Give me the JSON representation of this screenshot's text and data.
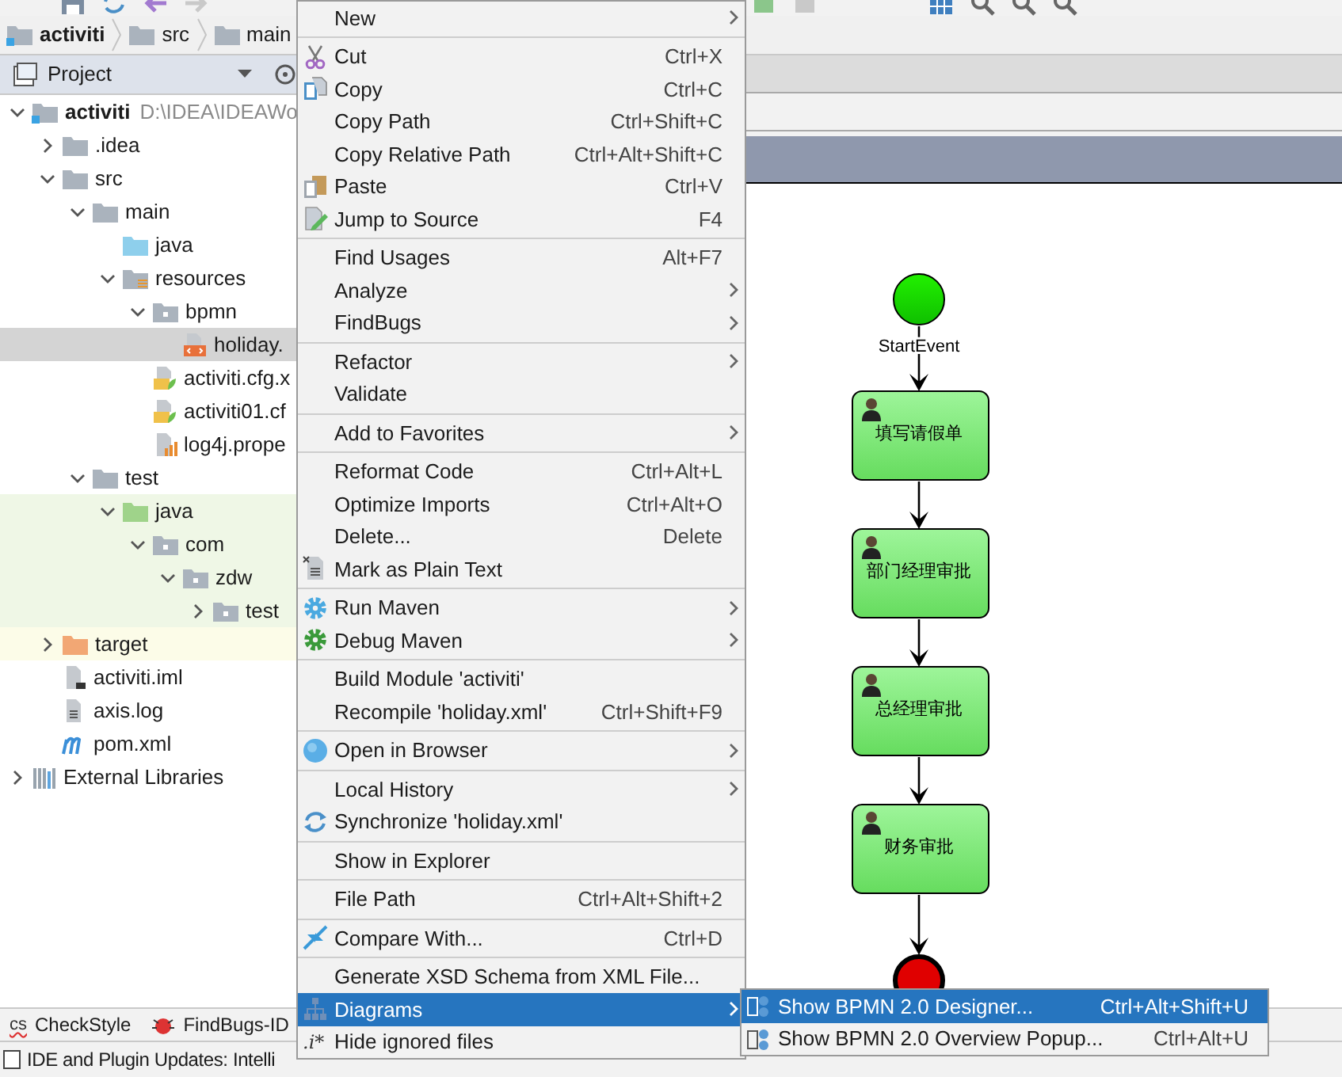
{
  "breadcrumb": [
    {
      "label": "activiti",
      "kind": "module"
    },
    {
      "label": "src",
      "kind": "folder"
    },
    {
      "label": "main",
      "kind": "folder"
    }
  ],
  "project_panel": {
    "title": "Project"
  },
  "tree": [
    {
      "label": "activiti",
      "path": "D:\\IDEA\\IDEAWo",
      "kind": "module",
      "expanded": true,
      "selected": false,
      "children": [
        {
          "label": ".idea",
          "kind": "folder",
          "expanded": false,
          "selected": false
        },
        {
          "label": "src",
          "kind": "folder",
          "expanded": true,
          "selected": false,
          "children": [
            {
              "label": "main",
              "kind": "folder",
              "expanded": true,
              "selected": false,
              "children": [
                {
                  "label": "java",
                  "kind": "source-folder",
                  "selected": false
                },
                {
                  "label": "resources",
                  "kind": "resources-folder",
                  "expanded": true,
                  "selected": false,
                  "children": [
                    {
                      "label": "bpmn",
                      "kind": "package",
                      "expanded": true,
                      "selected": false,
                      "children": [
                        {
                          "label": "holiday.",
                          "kind": "bpmn-file",
                          "selected": true
                        }
                      ]
                    },
                    {
                      "label": "activiti.cfg.x",
                      "kind": "spring-file",
                      "selected": false
                    },
                    {
                      "label": "activiti01.cf",
                      "kind": "spring-file",
                      "selected": false
                    },
                    {
                      "label": "log4j.prope",
                      "kind": "properties-file",
                      "selected": false
                    }
                  ]
                }
              ]
            },
            {
              "label": "test",
              "kind": "folder",
              "expanded": true,
              "selected": false,
              "children": [
                {
                  "label": "java",
                  "kind": "test-folder",
                  "expanded": true,
                  "selected": false,
                  "color": "#eff7e6",
                  "children": [
                    {
                      "label": "com",
                      "kind": "package",
                      "expanded": true,
                      "selected": false,
                      "color": "#eff7e6",
                      "children": [
                        {
                          "label": "zdw",
                          "kind": "package",
                          "expanded": true,
                          "selected": false,
                          "color": "#eff7e6",
                          "children": [
                            {
                              "label": "test",
                              "kind": "package",
                              "expanded": false,
                              "selected": false,
                              "color": "#eff7e6"
                            }
                          ]
                        }
                      ]
                    }
                  ]
                }
              ]
            }
          ]
        },
        {
          "label": "target",
          "kind": "excluded-folder",
          "expanded": false,
          "selected": false,
          "color": "#fcfce8"
        },
        {
          "label": "activiti.iml",
          "kind": "iml-file",
          "selected": false
        },
        {
          "label": "axis.log",
          "kind": "log-file",
          "selected": false
        },
        {
          "label": "pom.xml",
          "kind": "maven-file",
          "selected": false
        }
      ]
    },
    {
      "label": "External Libraries",
      "kind": "libraries",
      "expanded": false,
      "selected": false
    }
  ],
  "context_menu": [
    {
      "kind": "item",
      "label": "New",
      "submenu": true,
      "selected": false
    },
    {
      "kind": "separator"
    },
    {
      "kind": "item",
      "label": "Cut",
      "shortcut": "Ctrl+X",
      "submenu": false,
      "selected": false
    },
    {
      "kind": "item",
      "label": "Copy",
      "shortcut": "Ctrl+C",
      "submenu": false,
      "selected": false
    },
    {
      "kind": "item",
      "label": "Copy Path",
      "shortcut": "Ctrl+Shift+C",
      "submenu": false,
      "selected": false
    },
    {
      "kind": "item",
      "label": "Copy Relative Path",
      "shortcut": "Ctrl+Alt+Shift+C",
      "submenu": false,
      "selected": false
    },
    {
      "kind": "item",
      "label": "Paste",
      "shortcut": "Ctrl+V",
      "submenu": false,
      "selected": false
    },
    {
      "kind": "item",
      "label": "Jump to Source",
      "shortcut": "F4",
      "submenu": false,
      "selected": false
    },
    {
      "kind": "separator"
    },
    {
      "kind": "item",
      "label": "Find Usages",
      "shortcut": "Alt+F7",
      "submenu": false,
      "selected": false
    },
    {
      "kind": "item",
      "label": "Analyze",
      "submenu": true,
      "selected": false
    },
    {
      "kind": "item",
      "label": "FindBugs",
      "submenu": true,
      "selected": false
    },
    {
      "kind": "separator"
    },
    {
      "kind": "item",
      "label": "Refactor",
      "submenu": true,
      "selected": false
    },
    {
      "kind": "item",
      "label": "Validate",
      "submenu": false,
      "selected": false
    },
    {
      "kind": "separator"
    },
    {
      "kind": "item",
      "label": "Add to Favorites",
      "submenu": true,
      "selected": false
    },
    {
      "kind": "separator"
    },
    {
      "kind": "item",
      "label": "Reformat Code",
      "shortcut": "Ctrl+Alt+L",
      "submenu": false,
      "selected": false
    },
    {
      "kind": "item",
      "label": "Optimize Imports",
      "shortcut": "Ctrl+Alt+O",
      "submenu": false,
      "selected": false
    },
    {
      "kind": "item",
      "label": "Delete...",
      "shortcut": "Delete",
      "submenu": false,
      "selected": false
    },
    {
      "kind": "item",
      "label": "Mark as Plain Text",
      "submenu": false,
      "selected": false
    },
    {
      "kind": "separator"
    },
    {
      "kind": "item",
      "label": "Run Maven",
      "submenu": true,
      "selected": false
    },
    {
      "kind": "item",
      "label": "Debug Maven",
      "submenu": true,
      "selected": false
    },
    {
      "kind": "separator"
    },
    {
      "kind": "item",
      "label": "Build Module 'activiti'",
      "submenu": false,
      "selected": false
    },
    {
      "kind": "item",
      "label": "Recompile 'holiday.xml'",
      "shortcut": "Ctrl+Shift+F9",
      "submenu": false,
      "selected": false
    },
    {
      "kind": "separator"
    },
    {
      "kind": "item",
      "label": "Open in Browser",
      "submenu": true,
      "selected": false
    },
    {
      "kind": "separator"
    },
    {
      "kind": "item",
      "label": "Local History",
      "submenu": true,
      "selected": false
    },
    {
      "kind": "item",
      "label": "Synchronize 'holiday.xml'",
      "submenu": false,
      "selected": false
    },
    {
      "kind": "separator"
    },
    {
      "kind": "item",
      "label": "Show in Explorer",
      "submenu": false,
      "selected": false
    },
    {
      "kind": "separator"
    },
    {
      "kind": "item",
      "label": "File Path",
      "shortcut": "Ctrl+Alt+Shift+2",
      "submenu": false,
      "selected": false
    },
    {
      "kind": "separator"
    },
    {
      "kind": "item",
      "label": "Compare With...",
      "shortcut": "Ctrl+D",
      "submenu": false,
      "selected": false
    },
    {
      "kind": "separator"
    },
    {
      "kind": "item",
      "label": "Generate XSD Schema from XML File...",
      "submenu": false,
      "selected": false
    },
    {
      "kind": "item",
      "label": "Diagrams",
      "submenu": true,
      "selected": true
    },
    {
      "kind": "item",
      "label": "Hide ignored files",
      "icon_text": ".i*",
      "submenu": false,
      "selected": false
    }
  ],
  "submenu": [
    {
      "label": "Show BPMN 2.0 Designer...",
      "shortcut": "Ctrl+Alt+Shift+U",
      "selected": true
    },
    {
      "label": "Show BPMN 2.0 Overview Popup...",
      "shortcut": "Ctrl+Alt+U",
      "selected": false
    }
  ],
  "diagram": {
    "nodes": [
      {
        "kind": "start",
        "label": "StartEvent"
      },
      {
        "kind": "task",
        "label": "填写请假单"
      },
      {
        "kind": "task",
        "label": "部门经理审批"
      },
      {
        "kind": "task",
        "label": "总经理审批"
      },
      {
        "kind": "task",
        "label": "财务审批"
      },
      {
        "kind": "end"
      }
    ]
  },
  "tool_tabs": [
    {
      "icon_text": "cs",
      "label": "CheckStyle"
    },
    {
      "label": "FindBugs-ID"
    }
  ],
  "status_bar": {
    "text": "IDE and Plugin Updates: Intelli"
  }
}
